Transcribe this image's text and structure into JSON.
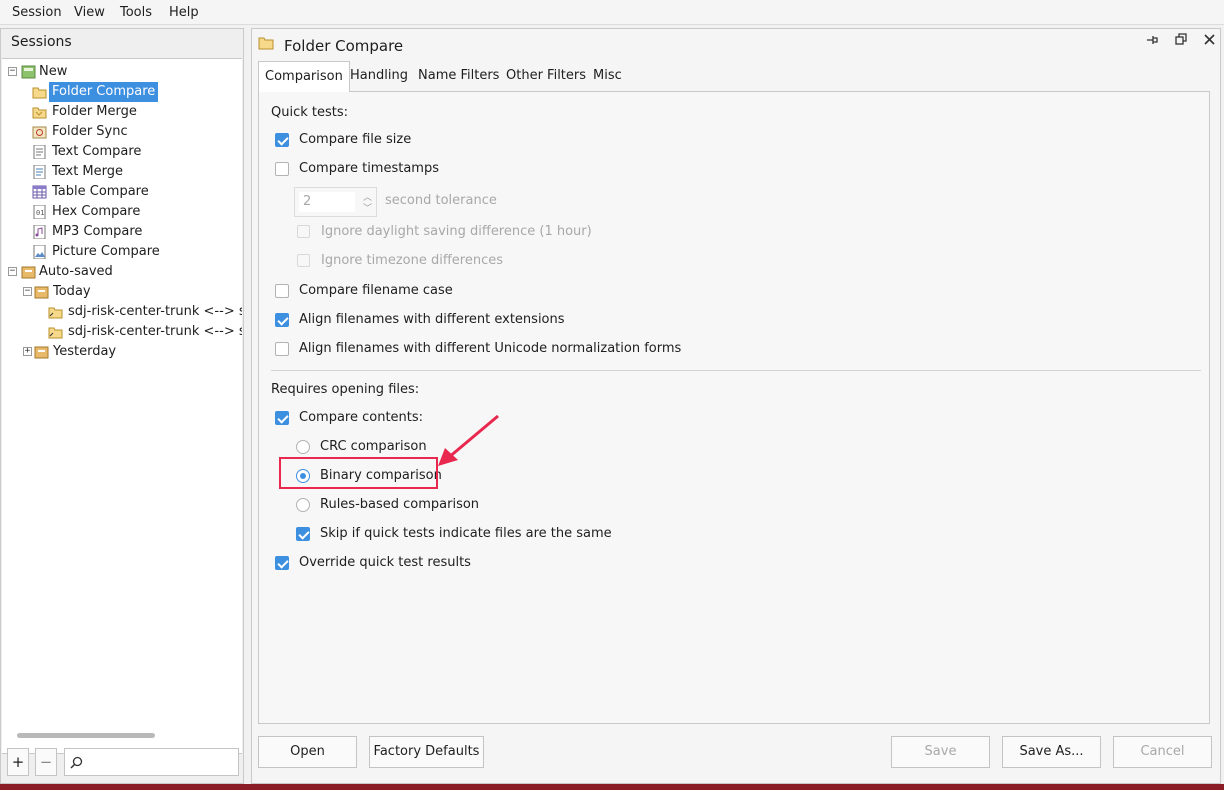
{
  "menu": [
    "Session",
    "View",
    "Tools",
    "Help"
  ],
  "sessions": {
    "title": "Sessions",
    "tree": [
      {
        "label": "New",
        "icon": "new-session-icon",
        "expander": "−"
      },
      {
        "label": "Folder Compare",
        "icon": "folder-compare-icon",
        "selected": true
      },
      {
        "label": "Folder Merge",
        "icon": "folder-merge-icon"
      },
      {
        "label": "Folder Sync",
        "icon": "folder-sync-icon"
      },
      {
        "label": "Text Compare",
        "icon": "text-compare-icon"
      },
      {
        "label": "Text Merge",
        "icon": "text-merge-icon"
      },
      {
        "label": "Table Compare",
        "icon": "table-compare-icon"
      },
      {
        "label": "Hex Compare",
        "icon": "hex-compare-icon"
      },
      {
        "label": "MP3 Compare",
        "icon": "mp3-compare-icon"
      },
      {
        "label": "Picture Compare",
        "icon": "picture-compare-icon"
      },
      {
        "label": "Auto-saved",
        "icon": "auto-saved-icon",
        "expander": "−"
      },
      {
        "label": "Today",
        "icon": "folder-icon",
        "expander": "−"
      },
      {
        "label": "sdj-risk-center-trunk <--> sdj-ri",
        "icon": "folder-compare-icon"
      },
      {
        "label": "sdj-risk-center-trunk <--> sdj-ri",
        "icon": "folder-compare-icon"
      },
      {
        "label": "Yesterday",
        "icon": "folder-icon",
        "expander": "+"
      }
    ],
    "add_label": "+",
    "remove_label": "−"
  },
  "main": {
    "title": "Folder Compare",
    "tabs": [
      "Comparison",
      "Handling",
      "Name Filters",
      "Other Filters",
      "Misc"
    ],
    "active_tab": "Comparison",
    "quick_tests_label": "Quick tests:",
    "compare_file_size": {
      "label": "Compare file size",
      "checked": true
    },
    "compare_timestamps": {
      "label": "Compare timestamps",
      "checked": false
    },
    "tolerance_value": "2",
    "tolerance_label": "second tolerance",
    "ignore_dst": {
      "label": "Ignore daylight saving difference (1 hour)",
      "checked": false
    },
    "ignore_tz": {
      "label": "Ignore timezone differences",
      "checked": false
    },
    "compare_case": {
      "label": "Compare filename case",
      "checked": false
    },
    "align_ext": {
      "label": "Align filenames with different extensions",
      "checked": true
    },
    "align_unicode": {
      "label": "Align filenames with different Unicode normalization forms",
      "checked": false
    },
    "requires_opening_label": "Requires opening files:",
    "compare_contents": {
      "label": "Compare contents:",
      "checked": true
    },
    "crc": {
      "label": "CRC comparison",
      "checked": false
    },
    "binary": {
      "label": "Binary comparison",
      "checked": true
    },
    "rules": {
      "label": "Rules-based comparison",
      "checked": false
    },
    "skip_quick": {
      "label": "Skip if quick tests indicate files are the same",
      "checked": true
    },
    "override_quick": {
      "label": "Override quick test results",
      "checked": true
    }
  },
  "footer": {
    "open": "Open",
    "factory_defaults": "Factory Defaults",
    "save": "Save",
    "save_as": "Save As...",
    "cancel": "Cancel"
  },
  "colors": {
    "accent": "#3d8fe0",
    "highlight": "#e8284e",
    "bottom_bar": "#8b1d26"
  }
}
